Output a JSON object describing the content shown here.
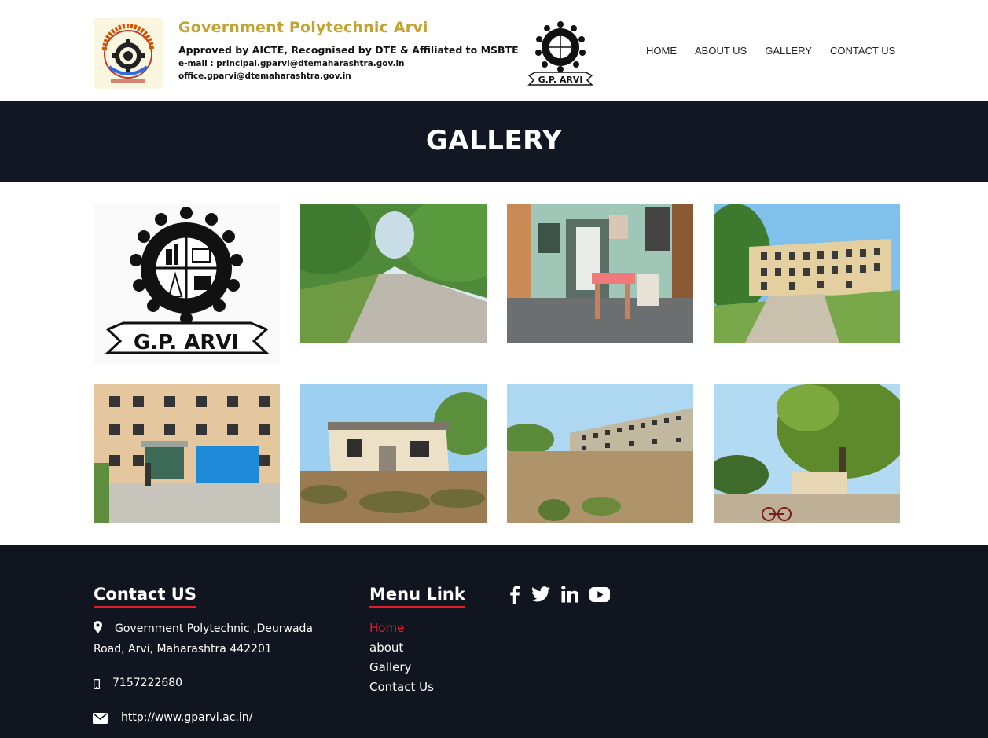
{
  "header": {
    "title": "Government Polytechnic Arvi",
    "subtitle": "Approved by AICTE, Recognised by DTE & Affiliated to MSBTE",
    "email_line1": "e-mail : principal.gparvi@dtemaharashtra.gov.in",
    "email_line2": "office.gparvi@dtemaharashtra.gov.in",
    "logo_caption": "G.P. ARVI"
  },
  "nav": {
    "items": [
      "HOME",
      "ABOUT US",
      "GALLERY",
      "CONTACT US"
    ]
  },
  "banner": {
    "title": "GALLERY"
  },
  "gallery": {
    "logo_caption": "G.P. ARVI",
    "items": [
      "gp-arvi-logo",
      "tree-lined-road-photo",
      "office-corridor-photo",
      "main-building-photo",
      "building-entrance-photo",
      "single-storey-building-photo",
      "campus-ground-photo",
      "trees-and-bicycles-photo"
    ]
  },
  "footer": {
    "contact_heading": "Contact US",
    "address_line1": "Government Polytechnic ,Deurwada",
    "address_line2": "Road, Arvi, Maharashtra 442201",
    "phone": "7157222680",
    "website": "http://www.gparvi.ac.in/",
    "menu_heading": "Menu Link",
    "menu_links": [
      "Home",
      "about",
      "Gallery",
      "Contact Us"
    ],
    "social_icons": [
      "facebook-icon",
      "twitter-icon",
      "linkedin-icon",
      "youtube-icon"
    ]
  },
  "colors": {
    "brand_gold": "#c2a334",
    "dark_bg": "#111723",
    "accent_red": "#e11d2a"
  }
}
